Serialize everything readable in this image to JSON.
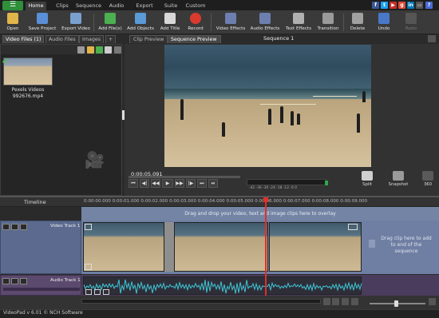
{
  "menu": {
    "app_menu_glyph": "☰",
    "tabs": [
      "Home",
      "Clips",
      "Sequence",
      "Audio",
      "Export",
      "Suite",
      "Custom"
    ],
    "active_tab": "Home"
  },
  "toolbar": {
    "open": "Open",
    "save_project": "Save Project",
    "export_video": "Export Video",
    "add_files": "Add File(s)",
    "add_objects": "Add Objects",
    "add_title": "Add Title",
    "record": "Record",
    "video_effects": "Video Effects",
    "audio_effects": "Audio Effects",
    "text_effects": "Text Effects",
    "transition": "Transition",
    "delete": "Delete",
    "undo": "Undo",
    "redo": "Redo"
  },
  "media_bin": {
    "tabs": [
      "Video Files",
      "Audio Files",
      "Images",
      "+"
    ],
    "video_count": "(1)",
    "clip": {
      "name_line1": "Pexels Videos",
      "name_line2": "992676.mp4"
    }
  },
  "preview": {
    "tabs": [
      "Clip Preview",
      "Sequence Preview"
    ],
    "active_tab": "Sequence Preview",
    "sequence_title": "Sequence 1",
    "time": "0:00:05.091",
    "meter_scale": "-42  -36  -30  -24  -18  -12   -6    0",
    "split_label": "Split",
    "snapshot_label": "Snapshot",
    "three60_label": "360"
  },
  "timeline": {
    "label": "Timeline",
    "ruler": "0:00:00.000      0:00:01.000      0:00:02.000      0:00:03.000      0:00:04.000      0:00:05.000      0:00:06.000      0:00:07.000      0:00:08.000      0:00:09.000",
    "overlay_hint": "Drag and drop your video, text and image clips here to overlay",
    "video_track": "Video Track 1",
    "audio_track": "Audio Track 1",
    "dropzone_line1": "Drag clip here to add",
    "dropzone_line2": "to end of the",
    "dropzone_line3": "sequence"
  },
  "status": {
    "text": "VideoPad v 6.01 © NCH Software"
  },
  "colors": {
    "accent_green": "#2f8f3a",
    "record_red": "#d83a2e",
    "audio_wave": "#3fc6d6",
    "playhead": "#e0302a"
  }
}
